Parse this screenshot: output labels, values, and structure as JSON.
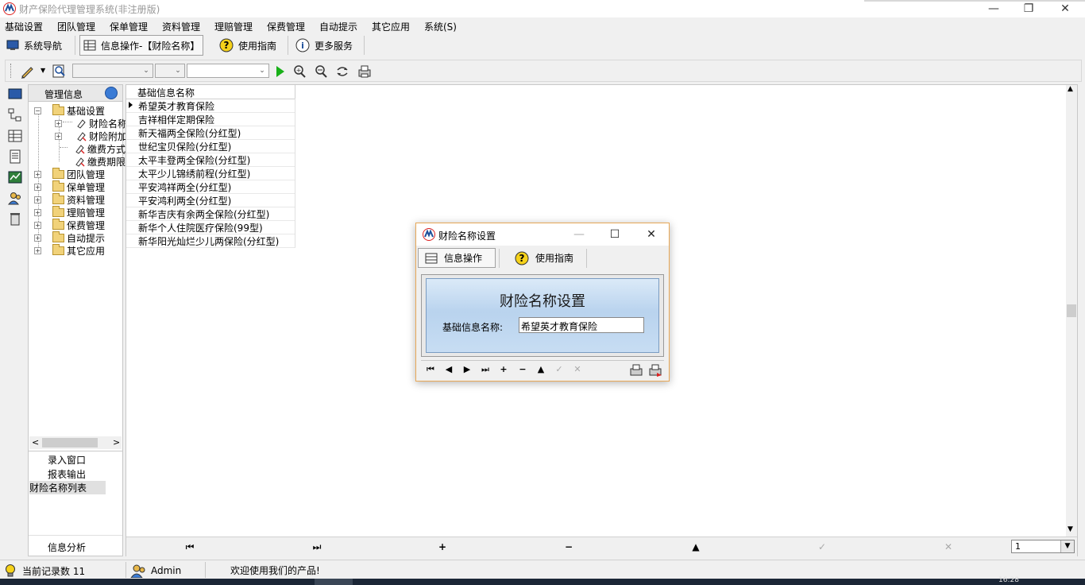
{
  "app": {
    "title": "财产保险代理管理系统(非注册版)",
    "accent": "#1e4f9a"
  },
  "window_controls": {
    "minimize": "—",
    "restore": "❐",
    "close": "✕"
  },
  "menu": [
    "基础设置",
    "团队管理",
    "保单管理",
    "资料管理",
    "理赔管理",
    "保费管理",
    "自动提示",
    "其它应用",
    "系统(S)"
  ],
  "toolbar1": {
    "nav": "系统导航",
    "info_op": "信息操作-【财险名称】",
    "guide": "使用指南",
    "more": "更多服务"
  },
  "toolbar2": {
    "icons": [
      "edit-icon",
      "preview-icon",
      "search-icon",
      "run-icon",
      "find-user-icon",
      "find-remove-icon",
      "refresh-icon",
      "print-icon"
    ]
  },
  "nav_panel": {
    "header": "管理信息",
    "tree": {
      "root": "基础设置",
      "children": [
        "财险名称",
        "财险附加",
        "缴费方式",
        "缴费期限"
      ],
      "siblings": [
        "团队管理",
        "保单管理",
        "资料管理",
        "理赔管理",
        "保费管理",
        "自动提示",
        "其它应用"
      ]
    },
    "links": [
      "录入窗口",
      "报表输出",
      "财险名称列表"
    ],
    "bottom": "信息分析"
  },
  "grid": {
    "column": "基础信息名称",
    "rows": [
      "希望英才教育保险",
      "吉祥相伴定期保险",
      "新天福两全保险(分红型)",
      "世纪宝贝保险(分红型)",
      "太平丰登两全保险(分红型)",
      "太平少儿锦绣前程(分红型)",
      "平安鸿祥两全(分红型)",
      "平安鸿利两全(分红型)",
      "新华吉庆有余两全保险(分红型)",
      "新华个人住院医疗保险(99型)",
      "新华阳光灿烂少儿两保险(分红型)"
    ],
    "page": "1"
  },
  "status": {
    "record_count": "当前记录数 11",
    "user": "Admin",
    "welcome": "欢迎使用我们的产品!"
  },
  "dialog": {
    "title": "财险名称设置",
    "tab_info": "信息操作",
    "tab_guide": "使用指南",
    "form_header": "财险名称设置",
    "field_label": "基础信息名称:",
    "field_value": "希望英才教育保险"
  },
  "taskbar": {
    "time": "16:28"
  }
}
